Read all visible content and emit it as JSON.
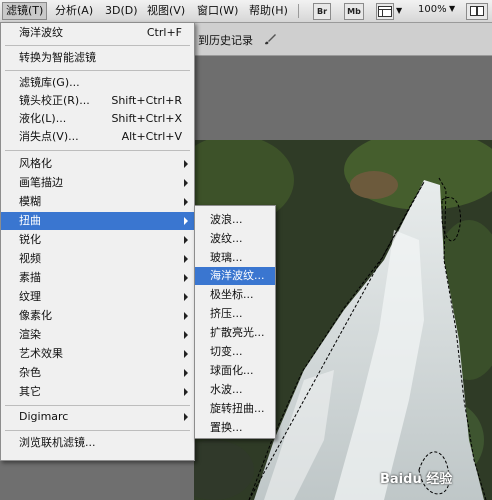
{
  "menubar": {
    "filter": "滤镜(T)",
    "analysis": "分析(A)",
    "three_d": "3D(D)",
    "view": "视图(V)",
    "window": "窗口(W)",
    "help": "帮助(H)",
    "zoom": "100%"
  },
  "toolbar_icons": [
    "Br",
    "Mb"
  ],
  "options_bar": {
    "history": "到历史记录"
  },
  "filter_menu": {
    "ocean_ripple": "海洋波纹",
    "ocean_ripple_shortcut": "Ctrl+F",
    "smart_filters": "转换为智能滤镜",
    "gallery": "滤镜库(G)...",
    "lens_correction": "镜头校正(R)...",
    "lens_correction_shortcut": "Shift+Ctrl+R",
    "liquify": "液化(L)...",
    "liquify_shortcut": "Shift+Ctrl+X",
    "vanishing_point": "消失点(V)...",
    "vanishing_point_shortcut": "Alt+Ctrl+V",
    "submenus": [
      "风格化",
      "画笔描边",
      "模糊",
      "扭曲",
      "锐化",
      "视频",
      "素描",
      "纹理",
      "像素化",
      "渲染",
      "艺术效果",
      "杂色",
      "其它"
    ],
    "digimarc": "Digimarc",
    "browse_online": "浏览联机滤镜..."
  },
  "distort_submenu": [
    "波浪...",
    "波纹...",
    "玻璃...",
    "海洋波纹...",
    "极坐标...",
    "挤压...",
    "扩散亮光...",
    "切变...",
    "球面化...",
    "水波...",
    "旋转扭曲...",
    "置换..."
  ],
  "watermark": "Baidu 经验"
}
